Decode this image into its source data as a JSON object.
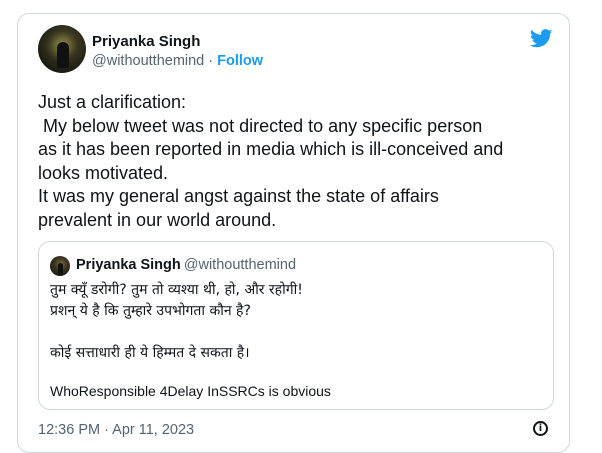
{
  "author": {
    "name": "Priyanka Singh",
    "handle": "@withoutthemind",
    "separator": " · ",
    "follow_label": "Follow",
    "avatar_icon": "user-avatar"
  },
  "brand": {
    "icon": "twitter-bird-icon",
    "color": "#1d9bf0"
  },
  "tweet": {
    "lines": [
      "Just a clarification:",
      " My below tweet was not directed to any specific person",
      "as it has been reported in media which is ill-conceived and",
      "looks motivated.",
      "It was my general angst against the state of affairs",
      "prevalent in our world around."
    ]
  },
  "quoted_tweet": {
    "name": "Priyanka Singh",
    "handle": "@withoutthemind",
    "lines": [
      "तुम क्यूँ डरोगी? तुम तो व्यश्या थी, हो, और रहोगी!",
      "प्रशन् ये है कि तुम्हारे उपभोगता कौन है?",
      "कोई सत्ताधारी ही ये हिम्मत दे सकता है।",
      "WhoResponsible 4Delay InSSRCs  is obvious"
    ]
  },
  "timestamp": "12:36 PM · Apr 11, 2023",
  "info_icon": "info-icon",
  "info_glyph": "i",
  "colors": {
    "text": "#0f1419",
    "secondary": "#536471",
    "accent": "#1d9bf0",
    "border": "#cfd9de"
  }
}
